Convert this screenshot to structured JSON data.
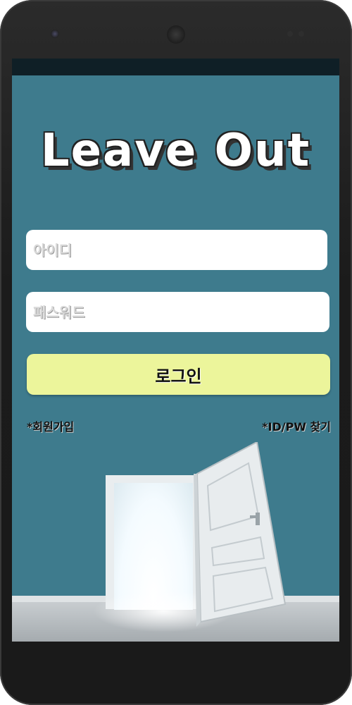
{
  "app": {
    "title": "Leave Out"
  },
  "login_form": {
    "id_placeholder": "아이디",
    "pw_placeholder": "패스워드",
    "login_label": "로그인"
  },
  "links": {
    "signup": "*회원가입",
    "find_account": "*ID/PW 찾기"
  },
  "colors": {
    "screen_bg": "#3e7b8d",
    "login_button": "#ecf59b",
    "field_bg": "#ffffff"
  },
  "decor": {
    "background_image": "open-door-illustration"
  }
}
